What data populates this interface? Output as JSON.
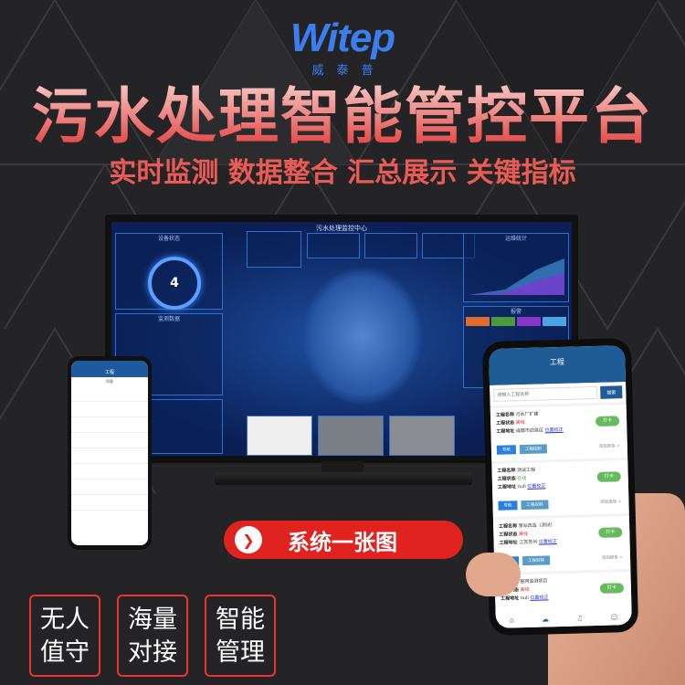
{
  "brand": {
    "logo_text": "Witep",
    "logo_cn": "威泰普",
    "color": "#3a7ef0"
  },
  "headline": "污水处理智能管控平台",
  "tagline": "实时监测 数据整合 汇总展示 关键指标",
  "dashboard": {
    "title": "污水处理监控中心",
    "gauge_value": "4",
    "panels": [
      "设备状态",
      "监测数据",
      "运维统计",
      "报警"
    ]
  },
  "small_phone": {
    "title": "工程",
    "tab": "列表"
  },
  "phone": {
    "title": "工程",
    "search_placeholder": "请输入工程名称",
    "search_button": "搜索",
    "labels": {
      "name": "工程名称",
      "status": "工程状态",
      "address": "工程地址"
    },
    "fix_link": "位置校正",
    "checkin": "打卡",
    "nav": "导航",
    "control": "工程控制",
    "more": "添加报告 >",
    "cards": [
      {
        "name": "污水厂扩建",
        "status": "离线",
        "status_type": "offline",
        "address": "成都市武侯区"
      },
      {
        "name": "测试工程",
        "status": "在线",
        "status_type": "online",
        "address": "null"
      },
      {
        "name": "泵站改造（测试）",
        "status": "离线",
        "status_type": "offline",
        "address": "江苏苏州"
      },
      {
        "name": "管网监测项目",
        "status": "离线",
        "status_type": "offline",
        "address": "null"
      }
    ],
    "colors": {
      "header": "#1f5c96",
      "online": "#44aa44",
      "offline": "#ee2222",
      "checkin": "#67bb5e"
    }
  },
  "cta": {
    "label": "系统一张图",
    "color": "#e1231f"
  },
  "features": [
    {
      "l1": "无人",
      "l2": "值守"
    },
    {
      "l1": "海量",
      "l2": "对接"
    },
    {
      "l1": "智能",
      "l2": "管理"
    }
  ]
}
